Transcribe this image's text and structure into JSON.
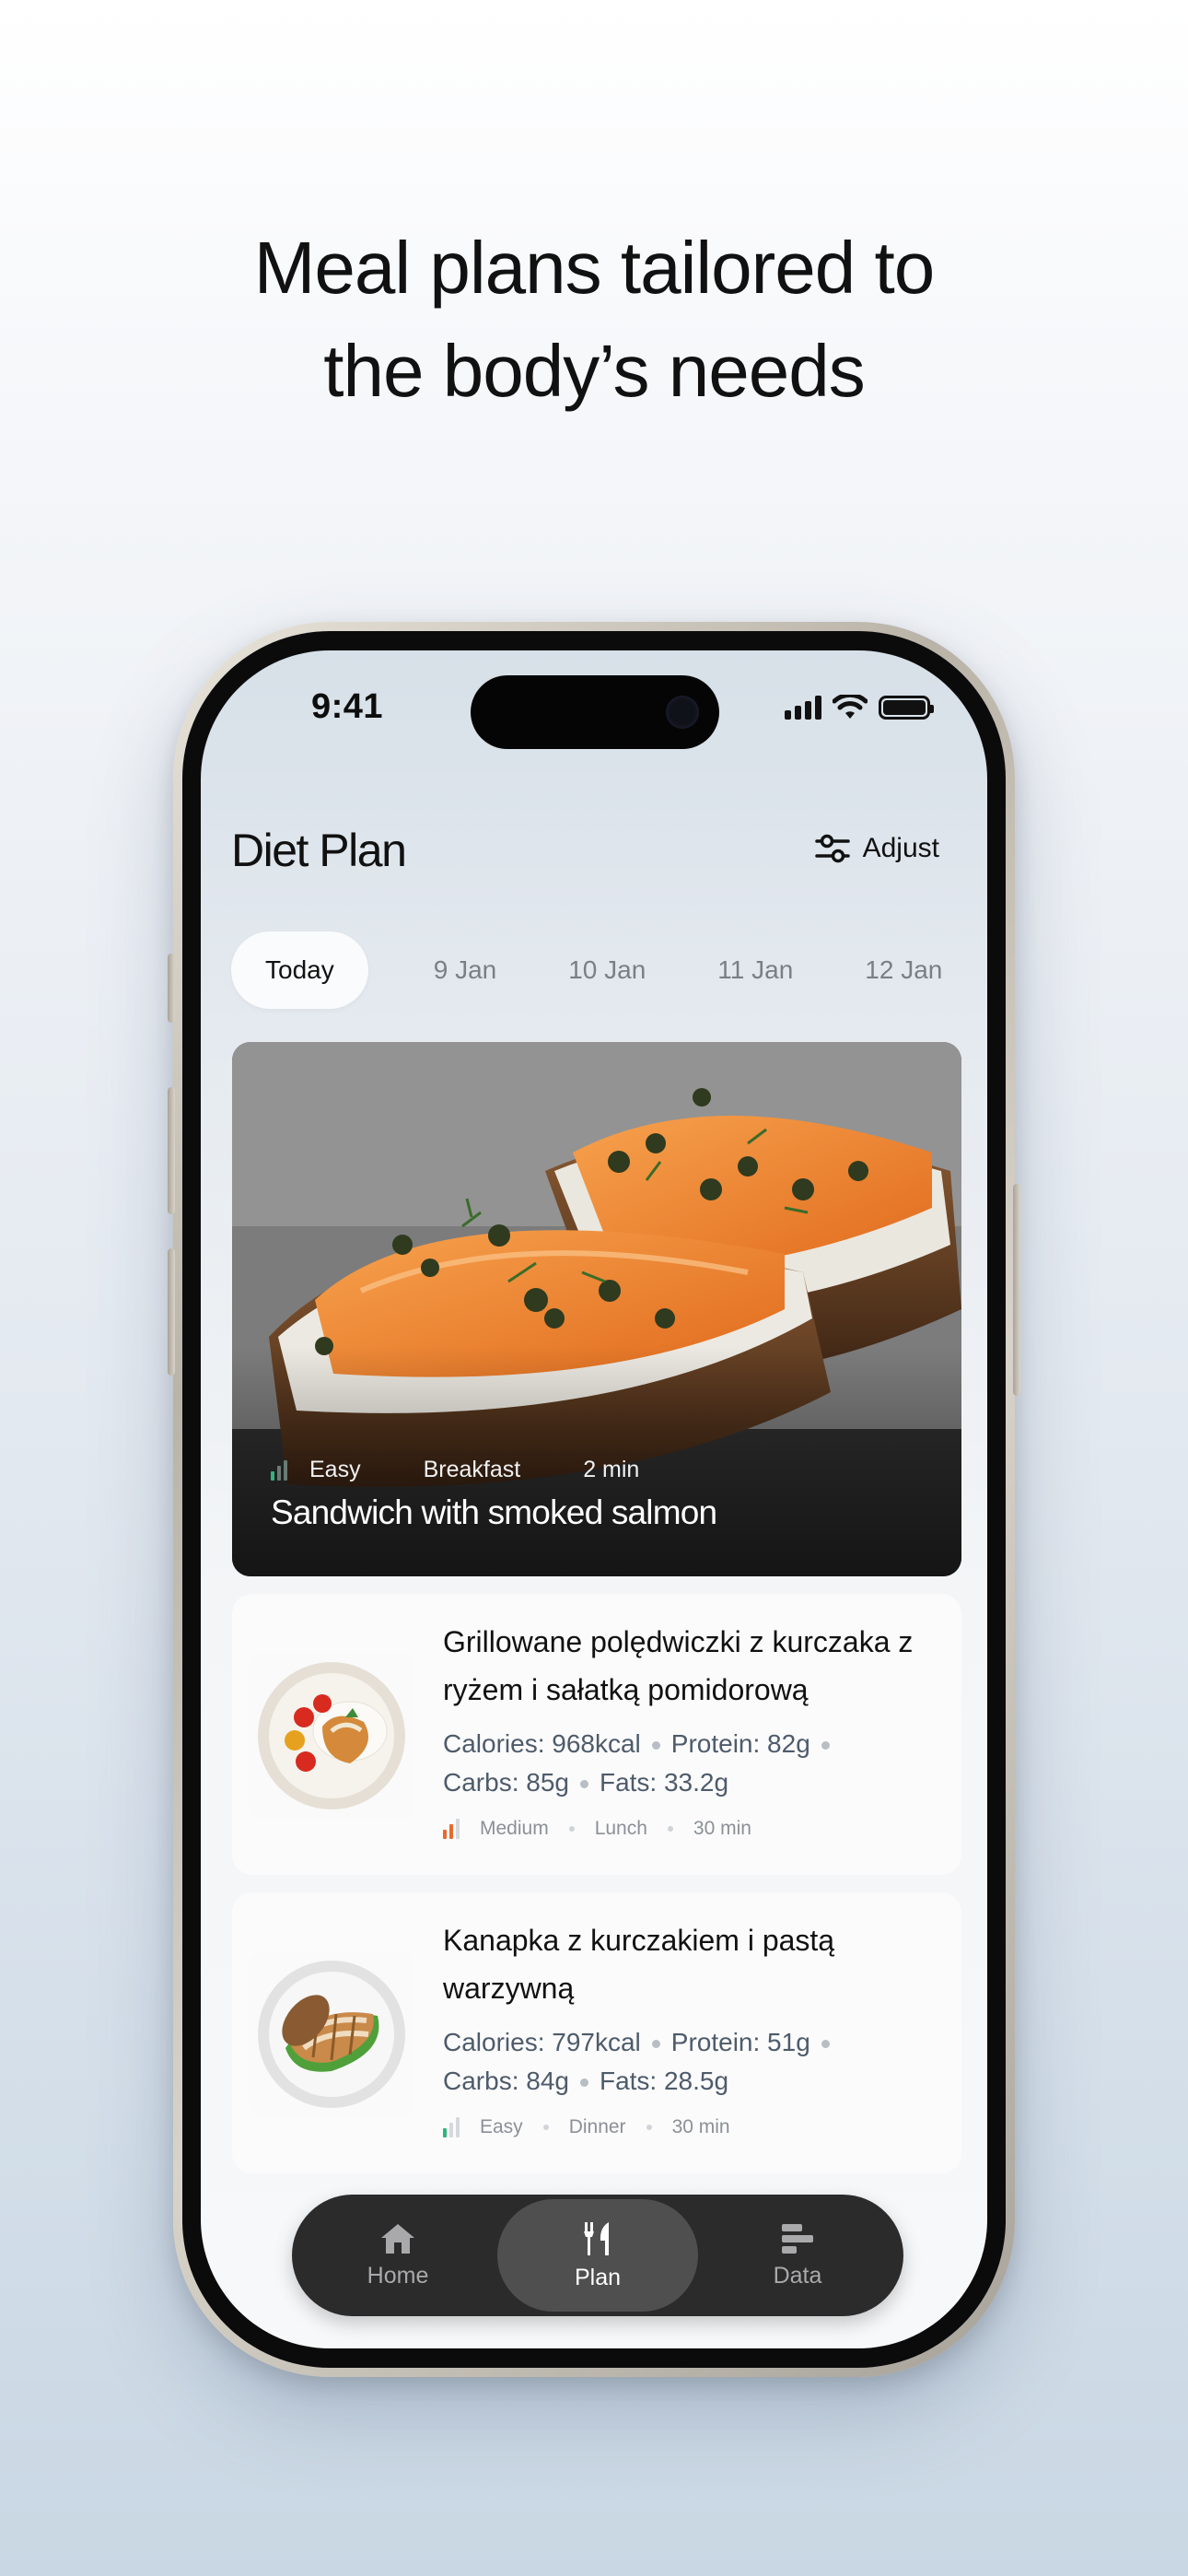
{
  "headline": {
    "line1": "Meal plans tailored to",
    "line2": "the body’s needs"
  },
  "status_bar": {
    "time": "9:41"
  },
  "header": {
    "title": "Diet Plan",
    "adjust_label": "Adjust"
  },
  "dates": [
    "Today",
    "9 Jan",
    "10 Jan",
    "11 Jan",
    "12 Jan"
  ],
  "featured": {
    "difficulty": "Easy",
    "meal_type": "Breakfast",
    "duration": "2 min",
    "title": "Sandwich with smoked salmon"
  },
  "meals": [
    {
      "name": "Grillowane polędwiczki z kurczaka z ryżem i sałatką pomidorową",
      "calories": "Calories: 968kcal",
      "protein": "Protein: 82g",
      "carbs": "Carbs: 85g",
      "fats": "Fats: 33.2g",
      "difficulty": "Medium",
      "meal_type": "Lunch",
      "duration": "30 min",
      "difficulty_color": "#e8692e"
    },
    {
      "name": "Kanapka z kurczakiem i pastą warzywną",
      "calories": "Calories: 797kcal",
      "protein": "Protein: 51g",
      "carbs": "Carbs: 84g",
      "fats": "Fats: 28.5g",
      "difficulty": "Easy",
      "meal_type": "Dinner",
      "duration": "30 min",
      "difficulty_color": "#2fb67c"
    }
  ],
  "tabbar": {
    "home": "Home",
    "plan": "Plan",
    "data": "Data",
    "active": "plan"
  },
  "colors": {
    "accent_easy": "#2fb67c",
    "accent_medium": "#e8692e",
    "tabbar_bg": "#2b2b2c"
  }
}
